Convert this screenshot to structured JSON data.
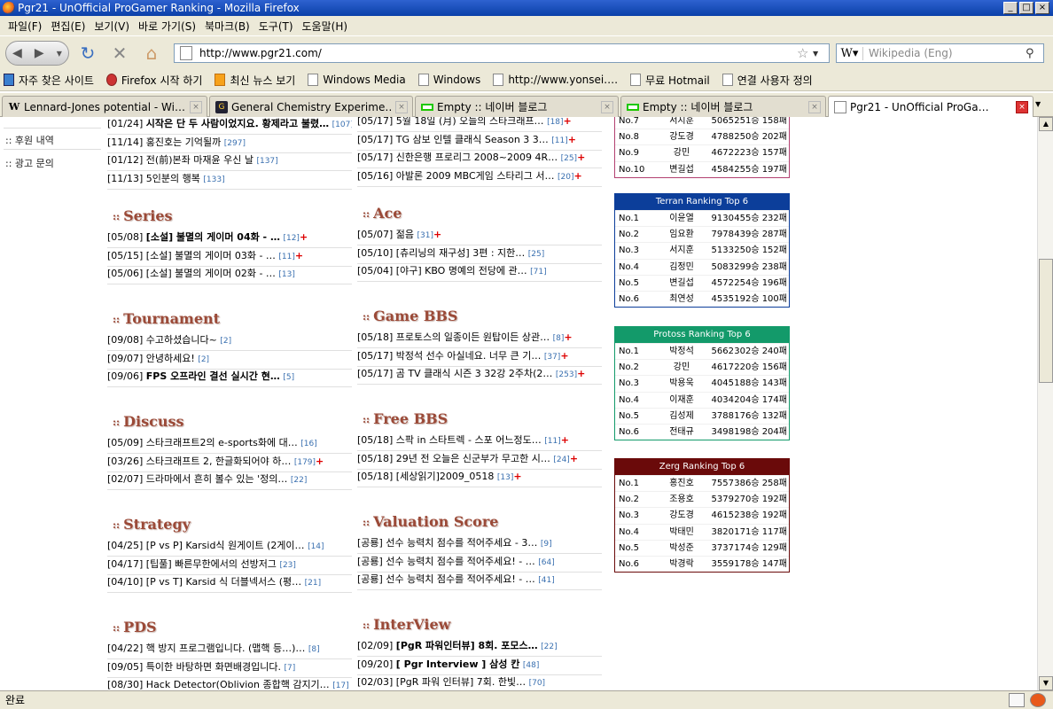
{
  "window": {
    "title": "Pgr21 - UnOfficial ProGamer Ranking - Mozilla Firefox"
  },
  "menu": [
    "파일(F)",
    "편집(E)",
    "보기(V)",
    "바로 가기(S)",
    "북마크(B)",
    "도구(T)",
    "도움말(H)"
  ],
  "address": {
    "url": "http://www.pgr21.com/"
  },
  "search": {
    "placeholder": "Wikipedia (Eng)"
  },
  "bookmarks": [
    "자주 찾은 사이트",
    "Firefox 시작 하기",
    "최신 뉴스 보기",
    "Windows Media",
    "Windows",
    "http://www.yonsei.…",
    "무료 Hotmail",
    "연결 사용자 정의"
  ],
  "tabs": [
    "Lennard-Jones potential - Wi…",
    "General Chemistry Experime…",
    "Empty :: 네이버 블로그",
    "Empty :: 네이버 블로그",
    "Pgr21 - UnOfficial ProGa…"
  ],
  "status": {
    "text": "완료"
  },
  "leftnav": [
    "후원 내역",
    "광고 문의"
  ],
  "col1": {
    "top": [
      {
        "d": "[01/24]",
        "t": "시작은 단 두 사람이었지요. 황제라고 불렸…",
        "c": "[107]",
        "b": true
      },
      {
        "d": "[11/14]",
        "t": "홍진호는 기억될까",
        "c": "[297]"
      },
      {
        "d": "[01/12]",
        "t": "전(前)본좌 마재윤 우신 날",
        "c": "[137]"
      },
      {
        "d": "[11/13]",
        "t": "5인분의 행복",
        "c": "[133]"
      }
    ],
    "sections": [
      {
        "title": "Series",
        "items": [
          {
            "d": "[05/08]",
            "t": "[소설] 불멸의 게이머 04화 - …",
            "c": "[12]",
            "n": "+",
            "b": true
          },
          {
            "d": "[05/15]",
            "t": "[소설] 불멸의 게이머 03화 - …",
            "c": "[11]",
            "n": "+"
          },
          {
            "d": "[05/06]",
            "t": "[소설] 불멸의 게이머 02화 - …",
            "c": "[13]"
          }
        ]
      },
      {
        "title": "Tournament",
        "items": [
          {
            "d": "[09/08]",
            "t": "수고하셨습니다~",
            "c": "[2]"
          },
          {
            "d": "[09/07]",
            "t": "안녕하세요!",
            "c": "[2]"
          },
          {
            "d": "[09/06]",
            "t": "FPS 오프라인 결선 실시간 현…",
            "c": "[5]",
            "b": true
          }
        ]
      },
      {
        "title": "Discuss",
        "items": [
          {
            "d": "[05/09]",
            "t": "스타크래프트2의 e-sports화에 대…",
            "c": "[16]"
          },
          {
            "d": "[03/26]",
            "t": "스타크래프트 2, 한글화되어야 하…",
            "c": "[179]",
            "n": "+"
          },
          {
            "d": "[02/07]",
            "t": "드라마에서 흔히 볼수 있는 '정의…",
            "c": "[22]"
          }
        ]
      },
      {
        "title": "Strategy",
        "items": [
          {
            "d": "[04/25]",
            "t": "[P vs P] Karsid식 원게이트 (2게이…",
            "c": "[14]"
          },
          {
            "d": "[04/17]",
            "t": "[팁풀] 빠른무한에서의 선방저그",
            "c": "[23]"
          },
          {
            "d": "[04/10]",
            "t": "[P vs T] Karsid 식 더블넥서스 (평…",
            "c": "[21]"
          }
        ]
      },
      {
        "title": "PDS",
        "items": [
          {
            "d": "[04/22]",
            "t": "핵 방지 프로그램입니다. (맵핵 등…)…",
            "c": "[8]"
          },
          {
            "d": "[09/05]",
            "t": "특이한 바탕하면 화면배경입니다.",
            "c": "[7]"
          },
          {
            "d": "[08/30]",
            "t": "Hack Detector(Oblivion 종합핵 감지기…",
            "c": "[17]"
          }
        ]
      }
    ]
  },
  "col2": {
    "top": [
      {
        "d": "[05/17]",
        "t": "5월 18일 (月) 오늘의 스타크래프…",
        "c": "[18]",
        "n": "+"
      },
      {
        "d": "[05/17]",
        "t": "TG 삼보 인텔 클래식 Season 3 3…",
        "c": "[11]",
        "n": "+"
      },
      {
        "d": "[05/17]",
        "t": "신한은행 프로리그 2008~2009 4R…",
        "c": "[25]",
        "n": "+"
      },
      {
        "d": "[05/16]",
        "t": "아발론 2009 MBC게임 스타리그 서…",
        "c": "[20]",
        "n": "+"
      }
    ],
    "sections": [
      {
        "title": "Ace",
        "items": [
          {
            "d": "[05/07]",
            "t": "젊음",
            "c": "[31]",
            "n": "+"
          },
          {
            "d": "[05/10]",
            "t": "[츄리닝의 재구성] 3편 : 지한…",
            "c": "[25]"
          },
          {
            "d": "[05/04]",
            "t": "[야구] KBO 명예의 전당에 관…",
            "c": "[71]"
          }
        ]
      },
      {
        "title": "Game BBS",
        "items": [
          {
            "d": "[05/18]",
            "t": "프로토스의 일종이든 원탑이든 상관…",
            "c": "[8]",
            "n": "+"
          },
          {
            "d": "[05/17]",
            "t": "박정석 선수 아실네요. 너무 큰 기…",
            "c": "[37]",
            "n": "+"
          },
          {
            "d": "[05/17]",
            "t": "곰 TV 클래식 시즌 3 32강 2주차(2…",
            "c": "[253]",
            "n": "+"
          }
        ]
      },
      {
        "title": "Free BBS",
        "items": [
          {
            "d": "[05/18]",
            "t": "스팍 in 스타트렉 - 스포 어느정도…",
            "c": "[11]",
            "n": "+"
          },
          {
            "d": "[05/18]",
            "t": "29년 전 오늘은 신군부가 무고한 시…",
            "c": "[24]",
            "n": "+"
          },
          {
            "d": "[05/18]",
            "t": "[세상읽기]2009_0518",
            "c": "[13]",
            "n": "+"
          }
        ]
      },
      {
        "title": "Valuation Score",
        "items": [
          {
            "d": "[공룡]",
            "t": "선수 능력치 점수를 적어주세요 - 3…",
            "c": "[9]"
          },
          {
            "d": "[공룡]",
            "t": "선수 능력치 점수를 적어주세요! - …",
            "c": "[64]"
          },
          {
            "d": "[공룡]",
            "t": "선수 능력치 점수를 적어주세요! - …",
            "c": "[41]"
          }
        ]
      },
      {
        "title": "InterView",
        "items": [
          {
            "d": "[02/09]",
            "t": "[PgR 파워인터뷰] 8회. 포모스…",
            "c": "[22]",
            "b": true
          },
          {
            "d": "[09/20]",
            "t": "[ Pgr Interview ] 삼성 칸",
            "c": "[48]",
            "b": true
          },
          {
            "d": "[02/03]",
            "t": "[PgR 파워 인터뷰] 7회. 한빛…",
            "c": "[70]"
          }
        ]
      }
    ]
  },
  "ranking_top": {
    "rows": [
      {
        "n": "No.7",
        "p": "서지훈",
        "s": "5065",
        "w": "251승 158패"
      },
      {
        "n": "No.8",
        "p": "강도경",
        "s": "4788",
        "w": "250승 202패"
      },
      {
        "n": "No.9",
        "p": "강민",
        "s": "4672",
        "w": "223승 157패"
      },
      {
        "n": "No.10",
        "p": "변길섭",
        "s": "4584",
        "w": "255승 197패"
      }
    ]
  },
  "rankings": [
    {
      "title": "Terran Ranking Top 6",
      "color": "#0c3e9a",
      "rows": [
        {
          "n": "No.1",
          "p": "이윤열",
          "s": "9130",
          "w": "455승 232패"
        },
        {
          "n": "No.2",
          "p": "임요환",
          "s": "7978",
          "w": "439승 287패"
        },
        {
          "n": "No.3",
          "p": "서지훈",
          "s": "5133",
          "w": "250승 152패"
        },
        {
          "n": "No.4",
          "p": "김정민",
          "s": "5083",
          "w": "299승 238패"
        },
        {
          "n": "No.5",
          "p": "변길섭",
          "s": "4572",
          "w": "254승 196패"
        },
        {
          "n": "No.6",
          "p": "최연성",
          "s": "4535",
          "w": "192승 100패"
        }
      ]
    },
    {
      "title": "Protoss Ranking Top 6",
      "color": "#139a6a",
      "rows": [
        {
          "n": "No.1",
          "p": "박정석",
          "s": "5662",
          "w": "302승 240패"
        },
        {
          "n": "No.2",
          "p": "강민",
          "s": "4617",
          "w": "220승 156패"
        },
        {
          "n": "No.3",
          "p": "박용욱",
          "s": "4045",
          "w": "188승 143패"
        },
        {
          "n": "No.4",
          "p": "이재훈",
          "s": "4034",
          "w": "204승 174패"
        },
        {
          "n": "No.5",
          "p": "김성제",
          "s": "3788",
          "w": "176승 132패"
        },
        {
          "n": "No.6",
          "p": "전태규",
          "s": "3498",
          "w": "198승 204패"
        }
      ]
    },
    {
      "title": "Zerg Ranking Top 6",
      "color": "#6a0a0a",
      "rows": [
        {
          "n": "No.1",
          "p": "홍진호",
          "s": "7557",
          "w": "386승 258패"
        },
        {
          "n": "No.2",
          "p": "조용호",
          "s": "5379",
          "w": "270승 192패"
        },
        {
          "n": "No.3",
          "p": "강도경",
          "s": "4615",
          "w": "238승 192패"
        },
        {
          "n": "No.4",
          "p": "박태민",
          "s": "3820",
          "w": "171승 117패"
        },
        {
          "n": "No.5",
          "p": "박성준",
          "s": "3737",
          "w": "174승 129패"
        },
        {
          "n": "No.6",
          "p": "박경락",
          "s": "3559",
          "w": "178승 147패"
        }
      ]
    }
  ]
}
